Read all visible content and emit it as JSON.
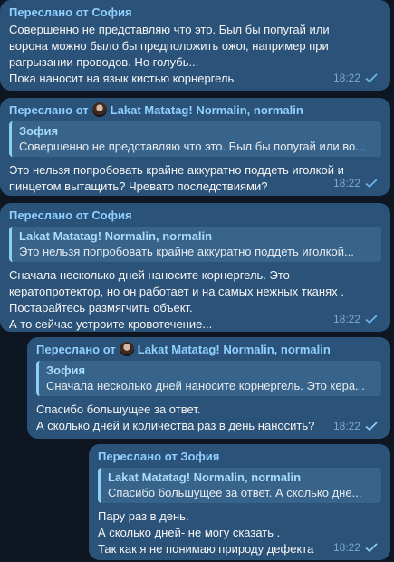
{
  "messages": [
    {
      "forward_label": "Переслано от",
      "forward_from": "София",
      "lines": [
        "Совершенно не представляю что это. Был бы попугай или",
        "ворона можно было бы предположить ожог, например при",
        "рагрызании проводов. Но голубь...",
        "Пока наносит на язык кистью корнергель"
      ],
      "time": "18:22"
    },
    {
      "forward_label": "Переслано от",
      "forward_from": "Lakat Matatag! Normalin, normalin",
      "quote_name": "Зофия",
      "quote_text": "Совершенно не представляю что это. Был бы попугай или во...",
      "lines": [
        "Это нельзя попробовать крайне аккуратно поддеть иголкой и",
        "пинцетом вытащить? Чревато последствиями?"
      ],
      "time": "18:22"
    },
    {
      "forward_label": "Переслано от",
      "forward_from": "София",
      "quote_name": "Lakat Matatag! Normalin, normalin",
      "quote_text": "Это нельзя попробовать крайне аккуратно поддеть иголкой...",
      "lines": [
        "Сначала несколько дней наносите корнергель. Это",
        "кератопротектор, но он работает и на самых нежных тканях .",
        "Постарайтесь размягчить объект.",
        "А то сейчас устроите кровотечение..."
      ],
      "time": "18:22"
    },
    {
      "forward_label": "Переслано от",
      "forward_from": "Lakat Matatag! Normalin, normalin",
      "quote_name": "Зофия",
      "quote_text": "Сначала несколько дней наносите корнергель. Это кера...",
      "lines": [
        "Спасибо большущее за ответ.",
        "А сколько дней и количества раз в день наносить?"
      ],
      "time": "18:22"
    },
    {
      "forward_label": "Переслано от",
      "forward_from": "Зофия",
      "quote_name": "Lakat Matatag! Normalin, normalin",
      "quote_text": "Спасибо большущее за ответ. А сколько дне...",
      "lines": [
        "Пару раз в день.",
        "А сколько дней- не могу сказать .",
        "Так как я не понимаю природу дефекта"
      ],
      "time": "18:22"
    }
  ],
  "colors": {
    "background": "#0e1621",
    "incoming_bubble": "#182533",
    "outgoing_bubble": "#2b5278",
    "accent": "#71baf2"
  }
}
